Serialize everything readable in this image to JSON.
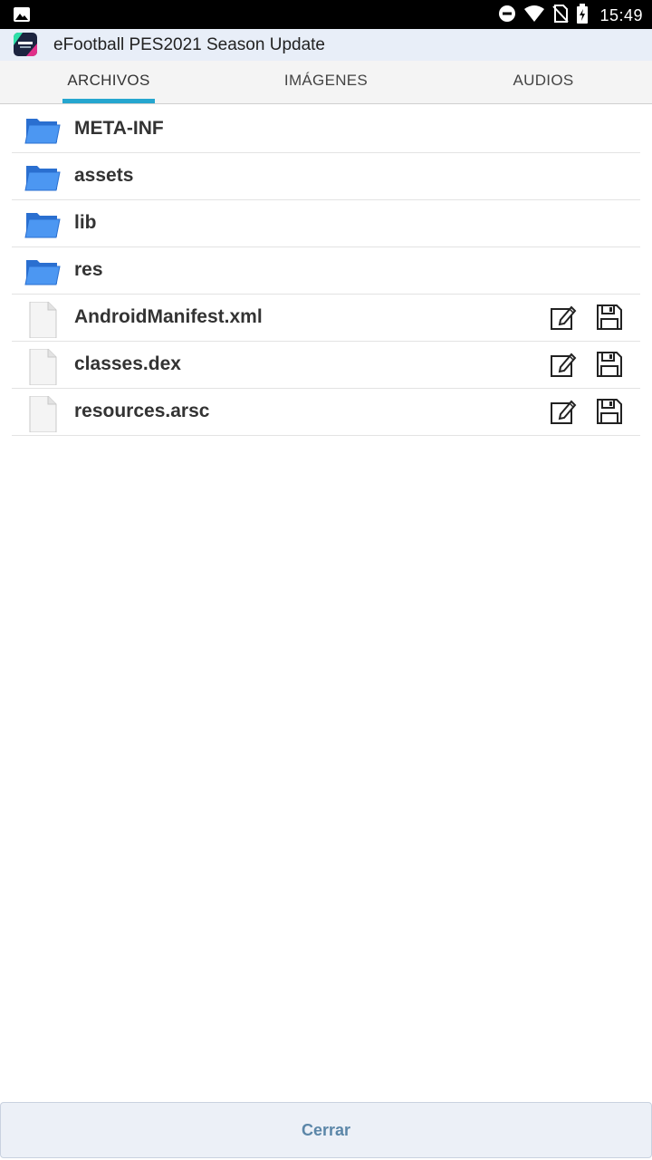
{
  "status_bar": {
    "time": "15:49",
    "icons": [
      "image-notification-icon",
      "do-not-disturb-icon",
      "wifi-icon",
      "no-sim-icon",
      "battery-charging-icon"
    ]
  },
  "app": {
    "title": "eFootball PES2021 Season Update",
    "icon": "efootball-app-icon"
  },
  "tabs": [
    {
      "label": "ARCHIVOS",
      "active": true
    },
    {
      "label": "IMÁGENES",
      "active": false
    },
    {
      "label": "AUDIOS",
      "active": false
    }
  ],
  "files": [
    {
      "name": "META-INF",
      "type": "folder",
      "icon": "folder-icon"
    },
    {
      "name": "assets",
      "type": "folder",
      "icon": "folder-icon"
    },
    {
      "name": "lib",
      "type": "folder",
      "icon": "folder-icon"
    },
    {
      "name": "res",
      "type": "folder",
      "icon": "folder-icon"
    },
    {
      "name": "AndroidManifest.xml",
      "type": "file",
      "icon": "file-icon",
      "actions": [
        "edit-icon",
        "save-icon"
      ]
    },
    {
      "name": "classes.dex",
      "type": "file",
      "icon": "file-icon",
      "actions": [
        "edit-icon",
        "save-icon"
      ]
    },
    {
      "name": "resources.arsc",
      "type": "file",
      "icon": "file-icon",
      "actions": [
        "edit-icon",
        "save-icon"
      ]
    }
  ],
  "footer": {
    "close_label": "Cerrar"
  },
  "colors": {
    "tab_indicator": "#25a6cf",
    "folder_blue": "#3d8cf0",
    "close_text": "#5b86a8",
    "appbar_bg": "#e8eef8"
  }
}
